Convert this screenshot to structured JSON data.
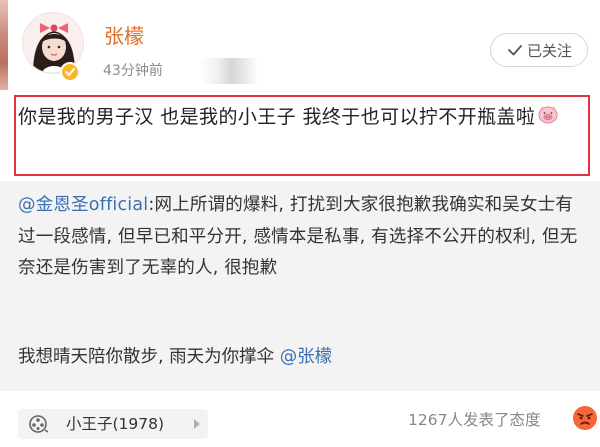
{
  "post": {
    "author": {
      "name": "张檬",
      "avatar_icon": "avatar-girl-with-bow",
      "verified_badge": "verified-icon"
    },
    "timestamp": "43分钟前",
    "follow_button": {
      "label": "已关注",
      "icon": "check-icon"
    },
    "text": "你是我的男子汉  也是我的小王子  我终于也可以拧不开瓶盖啦",
    "emoji": "pig-emoji-icon"
  },
  "repost": {
    "mention": "@金恩圣official",
    "text": ":网上所谓的爆料, 打扰到大家很抱歉我确实和吴女士有过一段感情, 但早已和平分开, 感情本是私事, 有选择不公开的权利, 但无奈还是伤害到了无辜的人, 很抱歉",
    "line2_text": "我想晴天陪你散步,  雨天为你撑伞 ",
    "line2_mention": "@张檬"
  },
  "footer": {
    "topic": "小王子(1978)",
    "topic_icon": "film-reel-icon",
    "reactions": "1267人发表了态度",
    "reaction_icon": "angry-face-icon"
  },
  "colors": {
    "username": "#e36c28",
    "mention": "#3a6fb0",
    "highlight_border": "#e0343a",
    "repost_bg": "#f3f3f3",
    "verified": "#f6b72a"
  }
}
